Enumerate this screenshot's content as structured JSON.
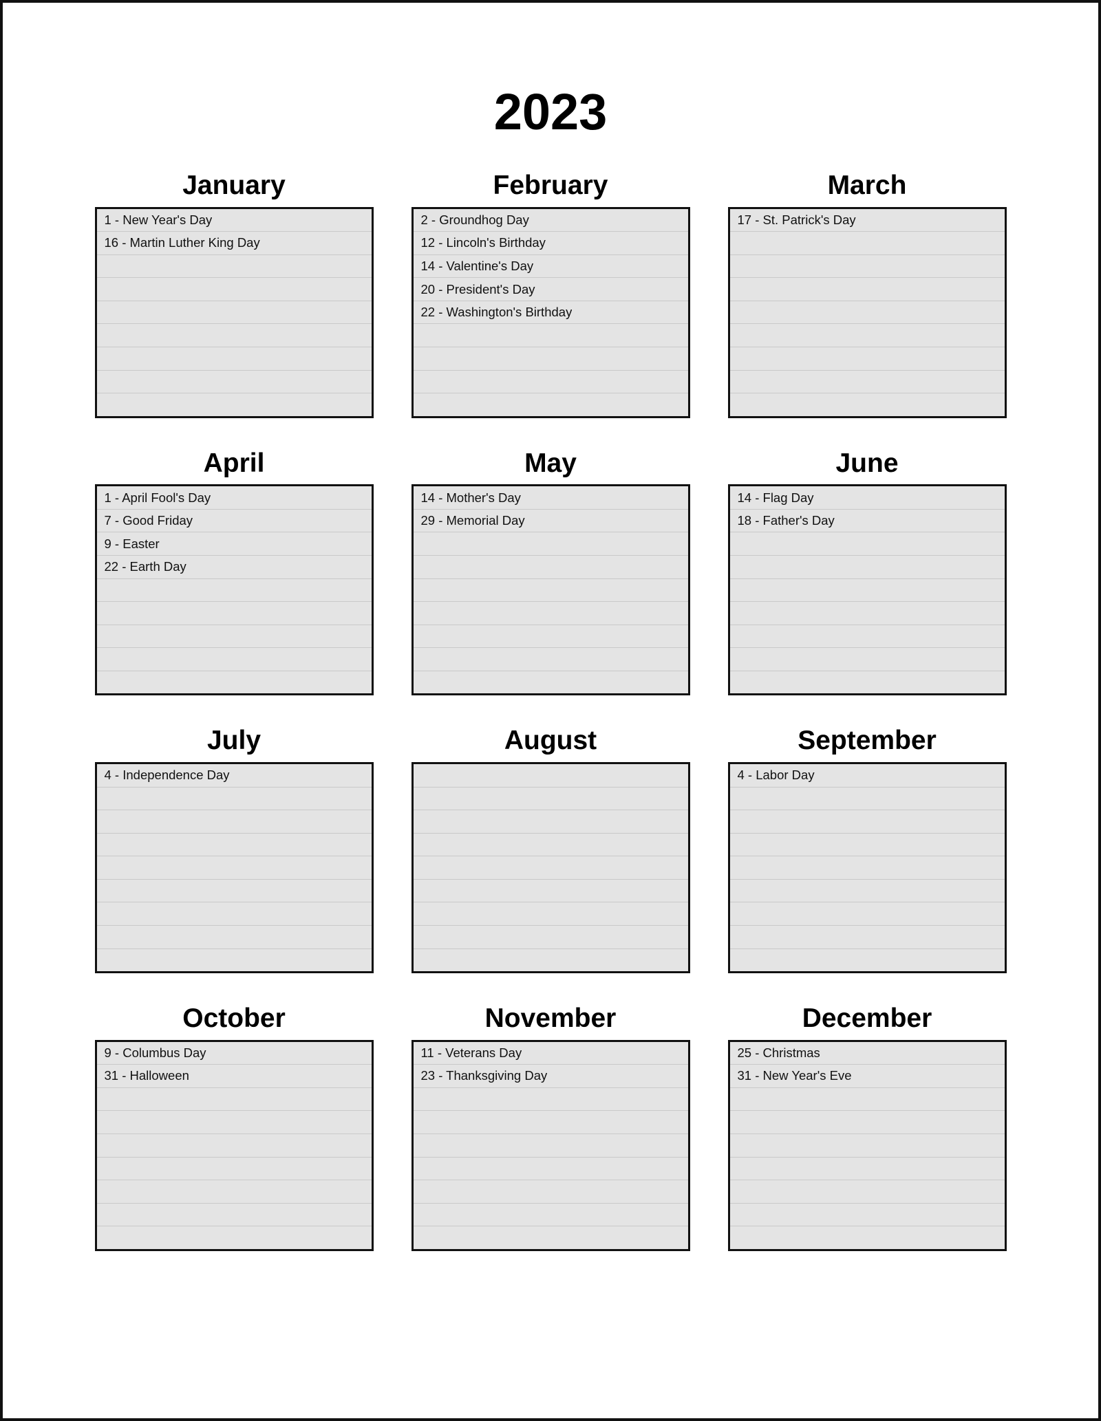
{
  "page": {
    "title": "2023",
    "rows_per_month": 9,
    "colors": {
      "page_border": "#111111",
      "box_border": "#111111",
      "row_fill": "#e4e4e4",
      "row_divider": "#c9c9c9",
      "text": "#111111"
    }
  },
  "months": [
    {
      "name": "January",
      "events": [
        "1 - New Year's Day",
        "16 - Martin Luther King Day"
      ]
    },
    {
      "name": "February",
      "events": [
        "2 - Groundhog Day",
        "12 - Lincoln's Birthday",
        "14 - Valentine's Day",
        "20 - President's Day",
        "22 - Washington's Birthday"
      ]
    },
    {
      "name": "March",
      "events": [
        "17 - St. Patrick's Day"
      ]
    },
    {
      "name": "April",
      "events": [
        "1 - April Fool's Day",
        "7 - Good Friday",
        "9 - Easter",
        "22 - Earth Day"
      ]
    },
    {
      "name": "May",
      "events": [
        "14 - Mother's Day",
        "29 - Memorial Day"
      ]
    },
    {
      "name": "June",
      "events": [
        "14 - Flag Day",
        "18 - Father's Day"
      ]
    },
    {
      "name": "July",
      "events": [
        "4 - Independence Day"
      ]
    },
    {
      "name": "August",
      "events": []
    },
    {
      "name": "September",
      "events": [
        "4 - Labor Day"
      ]
    },
    {
      "name": "October",
      "events": [
        "9 - Columbus Day",
        "31 - Halloween"
      ]
    },
    {
      "name": "November",
      "events": [
        "11 - Veterans Day",
        "23 - Thanksgiving Day"
      ]
    },
    {
      "name": "December",
      "events": [
        "25 - Christmas",
        "31 - New Year's Eve"
      ]
    }
  ]
}
